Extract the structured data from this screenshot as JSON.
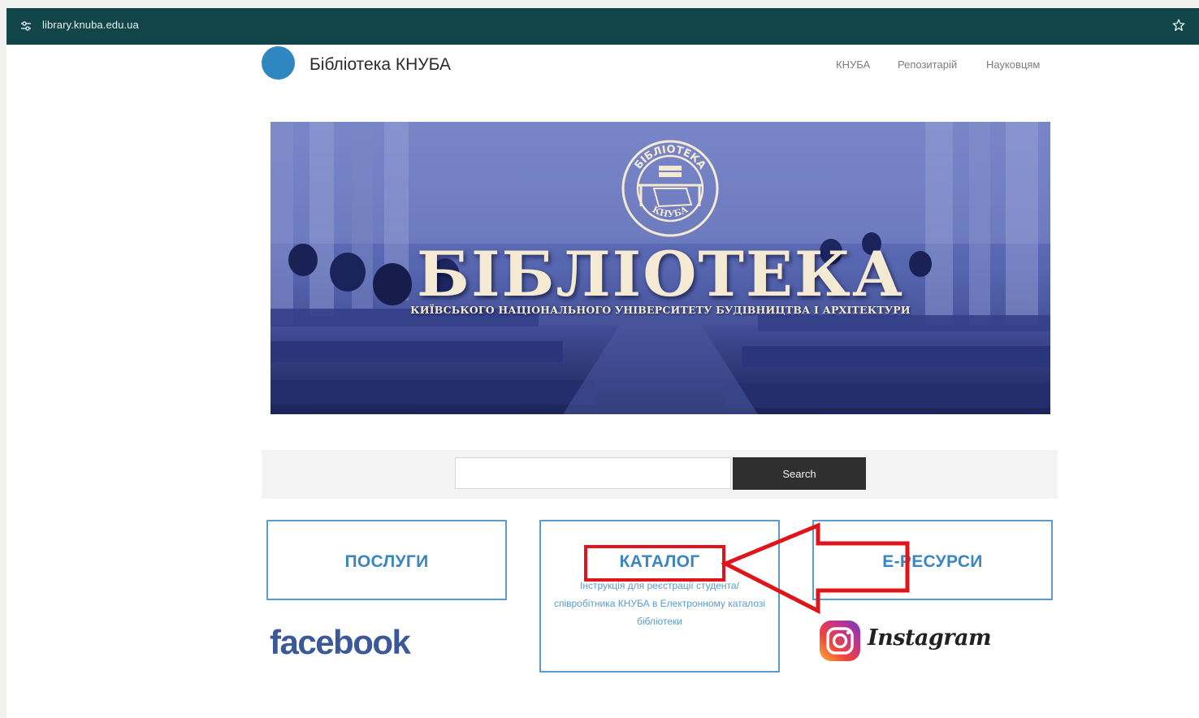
{
  "browser": {
    "url": "library.knuba.edu.ua",
    "icons": [
      "tune-icon",
      "star-icon"
    ]
  },
  "header": {
    "site_title": "Бібліотека КНУБА",
    "nav": [
      "КНУБА",
      "Репозитарій",
      "Науковцям"
    ]
  },
  "banner": {
    "seal_top": "БІБЛІОТЕКА",
    "seal_bottom": "КНУБА",
    "title": "БІБЛІОТЕКА",
    "subtitle": "КИЇВСЬКОГО НАЦІОНАЛЬНОГО УНІВЕРСИТЕТУ БУДІВНИЦТВА І АРХІТЕКТУРИ"
  },
  "search": {
    "value": "",
    "button_label": "Search"
  },
  "tiles": {
    "services": "ПОСЛУГИ",
    "catalog": "КАТАЛОГ",
    "catalog_desc": "Інструкція для реєстрації студента/ співробітника КНУБА в Електронному каталозі бібліотеки",
    "eresources": "Е-РЕСУРСИ"
  },
  "social": {
    "facebook": "facebook",
    "instagram": "Instagram"
  },
  "annotation": {
    "color": "#e0141b"
  }
}
